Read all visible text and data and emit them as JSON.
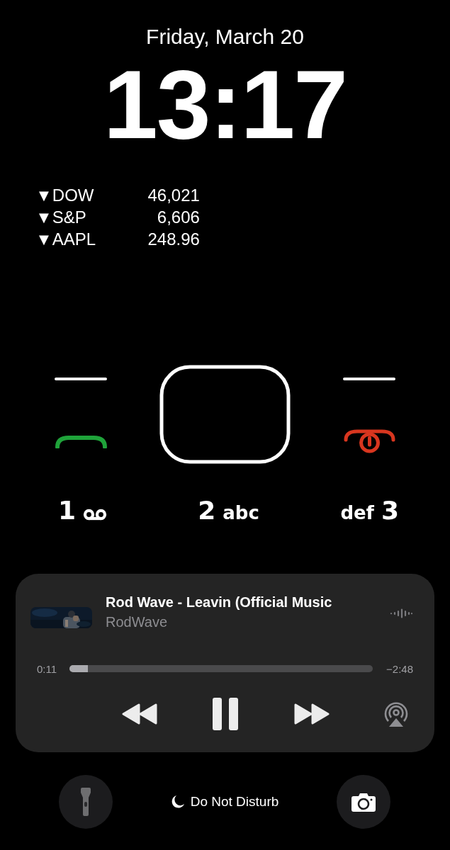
{
  "date": "Friday, March 20",
  "time": "13:17",
  "stocks": [
    {
      "symbol": "DOW",
      "value": "46,021",
      "trend": "▼"
    },
    {
      "symbol": "S&P",
      "value": "6,606",
      "trend": "▼"
    },
    {
      "symbol": "AAPL",
      "value": "248.96",
      "trend": "▼"
    }
  ],
  "keypad": [
    [
      {
        "digit": "1",
        "kind": "voicemail"
      },
      {
        "digit": "2",
        "letters": "abc",
        "kind": "letters-after"
      },
      {
        "digit": "3",
        "letters": "def",
        "kind": "letters-before"
      }
    ]
  ],
  "now_playing": {
    "title": "Rod Wave - Leavin (Official Music",
    "artist": "RodWave",
    "elapsed": "0:11",
    "remaining": "−2:48",
    "level": 0.06,
    "playing": true
  },
  "bottom_bar": {
    "focus": "Do Not Disturb"
  }
}
